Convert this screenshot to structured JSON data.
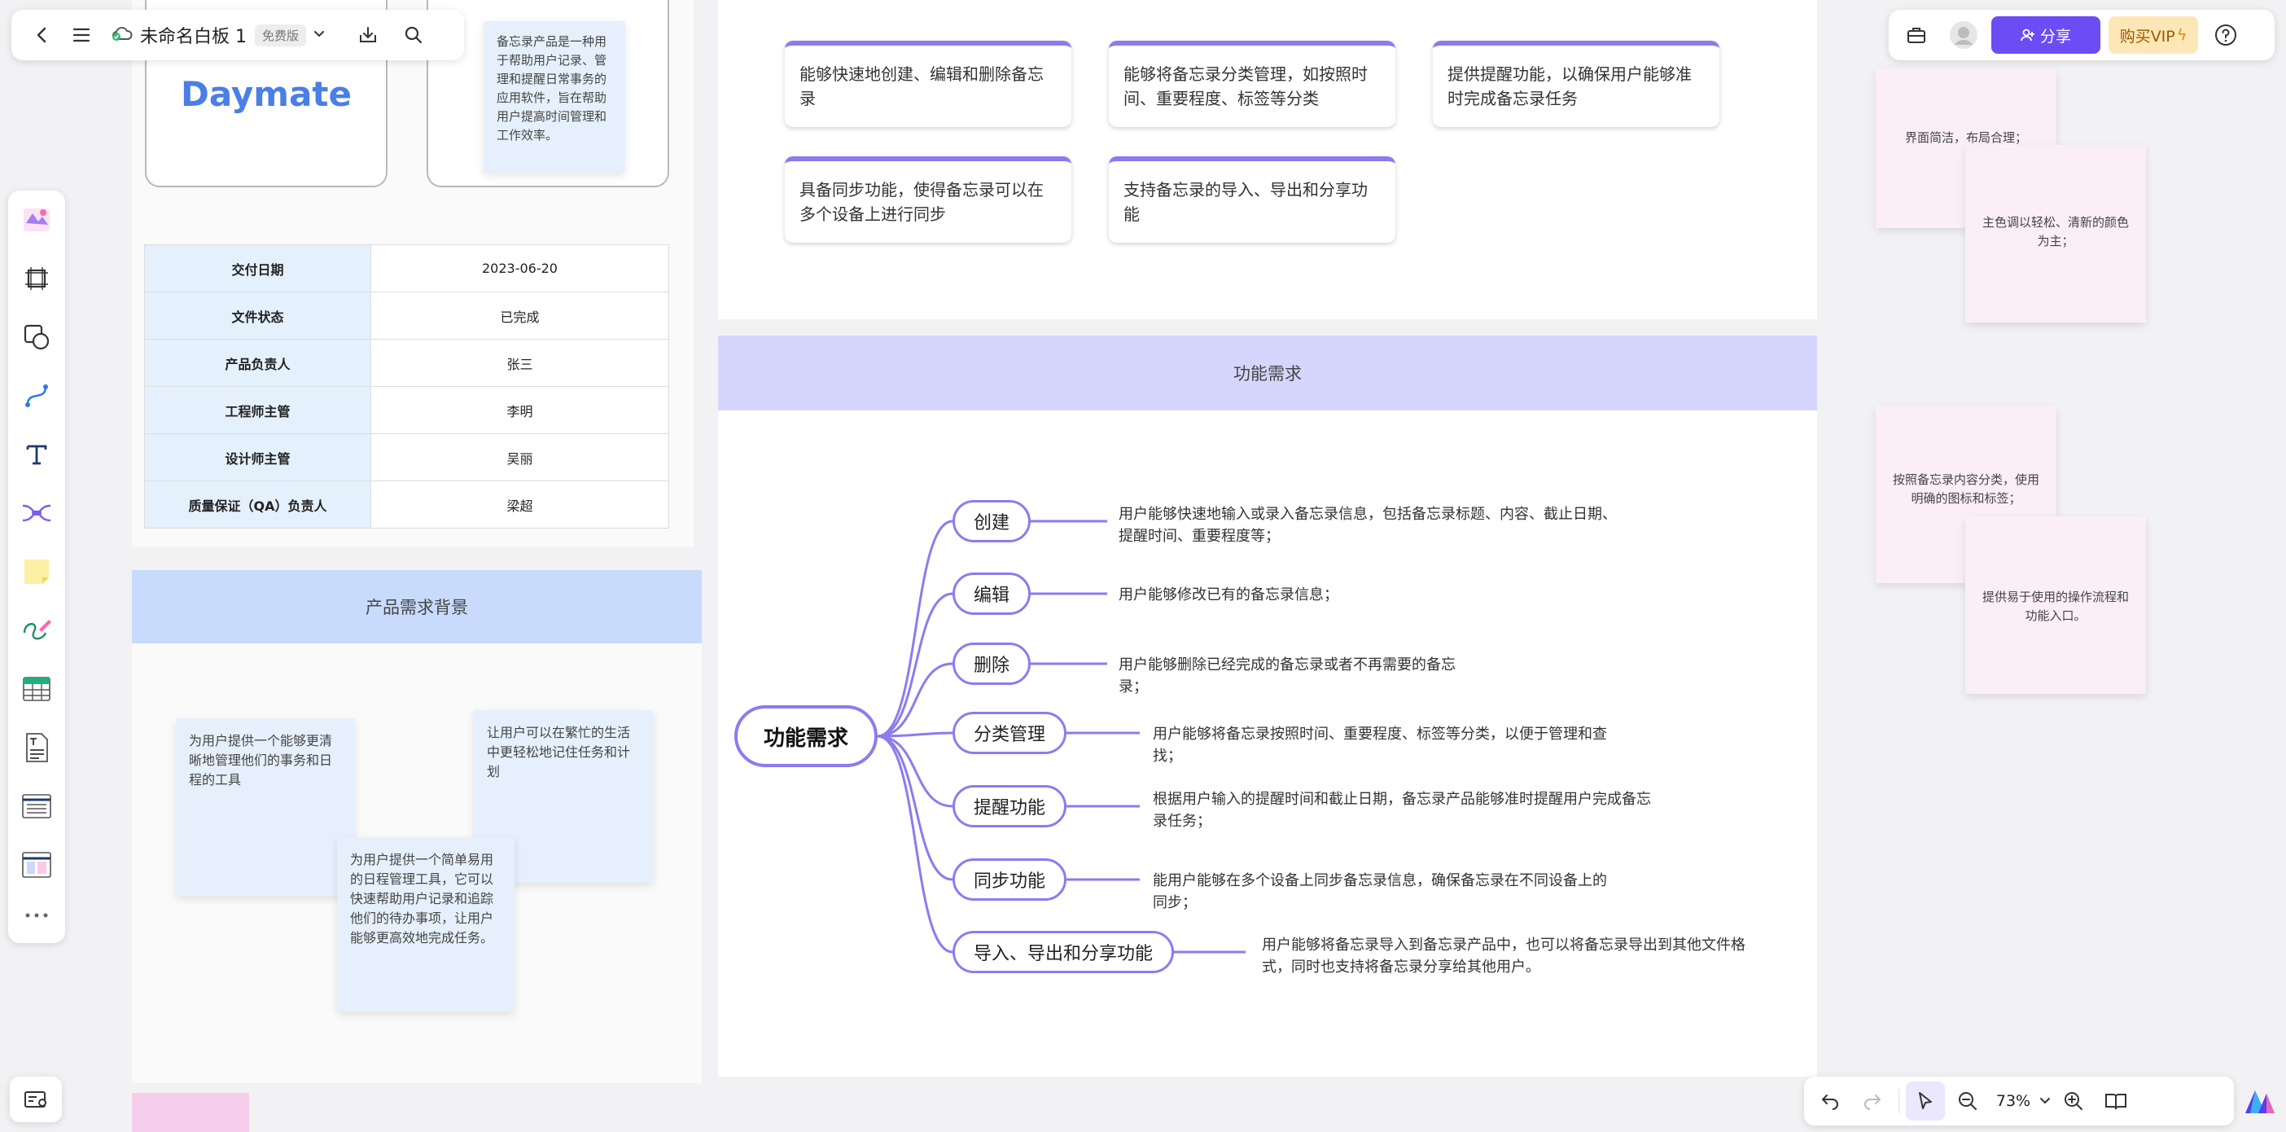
{
  "doc": {
    "title": "未命名白板 1",
    "plan_badge": "免费版"
  },
  "toolbar_right": {
    "share_label": "分享",
    "vip_label": "购买VIP"
  },
  "zoom": {
    "level": "73%"
  },
  "colors": {
    "accent": "#6c4cf5",
    "node_border": "#8a7cf0",
    "header_blue": "#c8dbfd",
    "header_purple": "#d6d5fd",
    "note_blue": "#e6f0fc",
    "note_pink": "#fbeef7"
  },
  "left_rail": [
    {
      "name": "template-icon"
    },
    {
      "name": "frame-icon"
    },
    {
      "name": "shape-icon"
    },
    {
      "name": "connector-icon"
    },
    {
      "name": "text-icon"
    },
    {
      "name": "mindmap-icon"
    },
    {
      "name": "sticky-note-icon"
    },
    {
      "name": "pen-icon"
    },
    {
      "name": "table-icon"
    },
    {
      "name": "doc-icon"
    },
    {
      "name": "list-icon"
    },
    {
      "name": "layout-icon"
    },
    {
      "name": "more-icon"
    }
  ],
  "product": {
    "logo_text": "Daymate",
    "intro_note": "备忘录产品是一种用于帮助用户记录、管理和提醒日常事务的应用软件，旨在帮助用户提高时间管理和工作效率。"
  },
  "info_table": [
    {
      "key": "交付日期",
      "value": "2023-06-20"
    },
    {
      "key": "文件状态",
      "value": "已完成"
    },
    {
      "key": "产品负责人",
      "value": "张三"
    },
    {
      "key": "工程师主管",
      "value": "李明"
    },
    {
      "key": "设计师主管",
      "value": "吴丽"
    },
    {
      "key": "质量保证（QA）负责人",
      "value": "梁超"
    }
  ],
  "background_section": {
    "title": "产品需求背景",
    "notes": [
      "为用户提供一个能够更清晰地管理他们的事务和日程的工具",
      "让用户可以在繁忙的生活中更轻松地记住任务和计划",
      "为用户提供一个简单易用的日程管理工具，它可以快速帮助用户记录和追踪他们的待办事项，让用户能够更高效地完成任务。"
    ]
  },
  "features_top": [
    "能够快速地创建、编辑和删除备忘录",
    "能够将备忘录分类管理，如按照时间、重要程度、标签等分类",
    "提供提醒功能，以确保用户能够准时完成备忘录任务",
    "具备同步功能，使得备忘录可以在多个设备上进行同步",
    "支持备忘录的导入、导出和分享功能"
  ],
  "function_section": {
    "title": "功能需求",
    "root": "功能需求",
    "branches": [
      {
        "label": "创建",
        "desc": "用户能够快速地输入或录入备忘录信息，包括备忘录标题、内容、截止日期、提醒时间、重要程度等；"
      },
      {
        "label": "编辑",
        "desc": "用户能够修改已有的备忘录信息；"
      },
      {
        "label": "删除",
        "desc": "用户能够删除已经完成的备忘录或者不再需要的备忘录；"
      },
      {
        "label": "分类管理",
        "desc": "用户能够将备忘录按照时间、重要程度、标签等分类，以便于管理和查找；"
      },
      {
        "label": "提醒功能",
        "desc": "根据用户输入的提醒时间和截止日期，备忘录产品能够准时提醒用户完成备忘录任务；"
      },
      {
        "label": "同步功能",
        "desc": "能用户能够在多个设备上同步备忘录信息，确保备忘录在不同设备上的同步；"
      },
      {
        "label": "导入、导出和分享功能",
        "desc": "用户能够将备忘录导入到备忘录产品中，也可以将备忘录导出到其他文件格式，同时也支持将备忘录分享给其他用户。"
      }
    ]
  },
  "design_notes": [
    "界面简洁，布局合理；",
    "主色调以轻松、清新的颜色为主；",
    "按照备忘录内容分类，使用明确的图标和标签；",
    "提供易于使用的操作流程和功能入口。"
  ]
}
